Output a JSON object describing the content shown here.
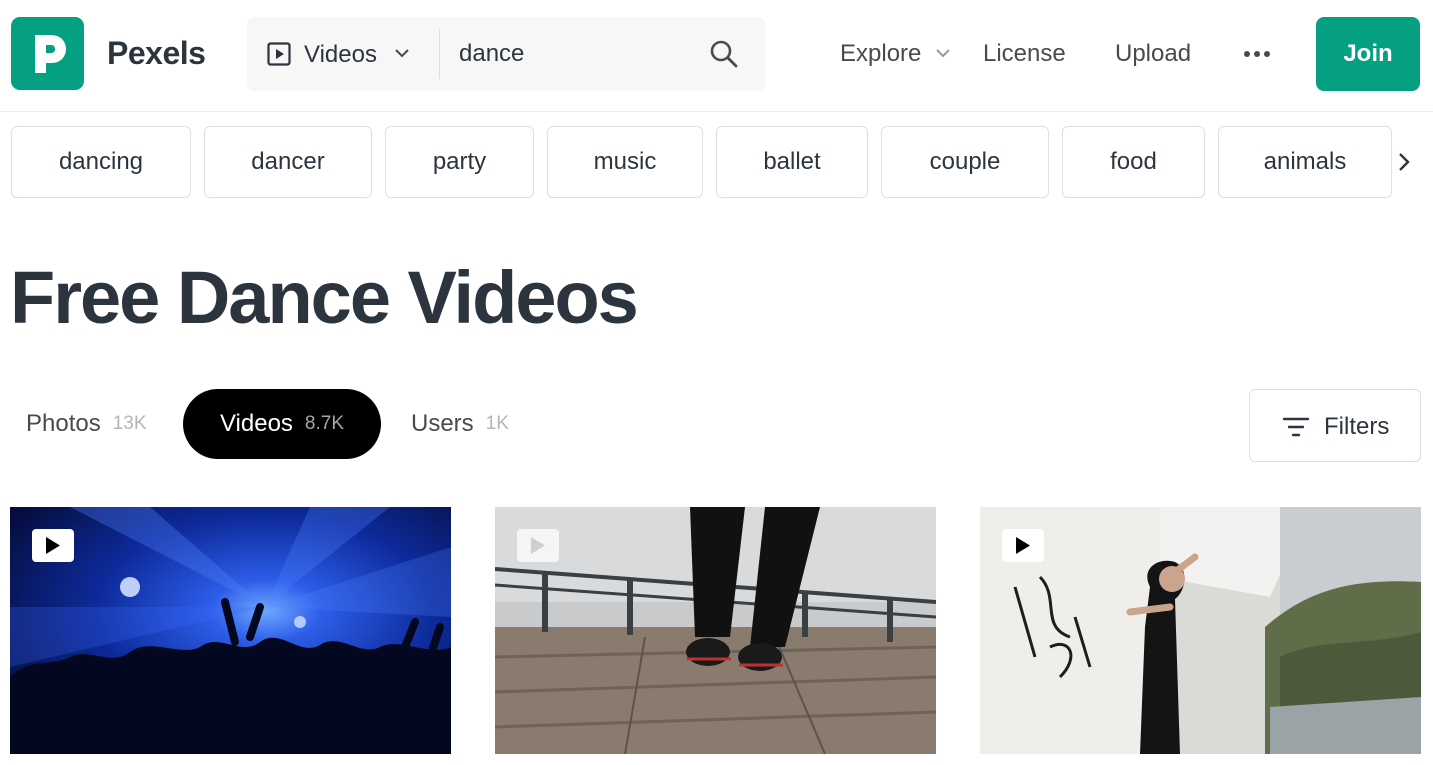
{
  "brand": {
    "name": "Pexels",
    "color": "#05a081"
  },
  "search": {
    "type_label": "Videos",
    "value": "dance"
  },
  "nav": {
    "explore": "Explore",
    "license": "License",
    "upload": "Upload",
    "join": "Join"
  },
  "tags": [
    "dancing",
    "dancer",
    "party",
    "music",
    "ballet",
    "couple",
    "food",
    "animals"
  ],
  "page_title": "Free Dance Videos",
  "tabs": [
    {
      "label": "Photos",
      "count": "13K"
    },
    {
      "label": "Videos",
      "count": "8.7K",
      "active": true
    },
    {
      "label": "Users",
      "count": "1K"
    }
  ],
  "filters_label": "Filters",
  "icons": [
    "pexels-logo-icon",
    "video-play-icon",
    "chevron-down-icon",
    "search-icon",
    "more-dots-icon",
    "chevron-right-icon",
    "filter-lines-icon"
  ],
  "videos": [
    {
      "scene": "blue concert lights over crowd"
    },
    {
      "scene": "dancer feet on wooden deck"
    },
    {
      "scene": "dancer by graffiti wall"
    }
  ]
}
